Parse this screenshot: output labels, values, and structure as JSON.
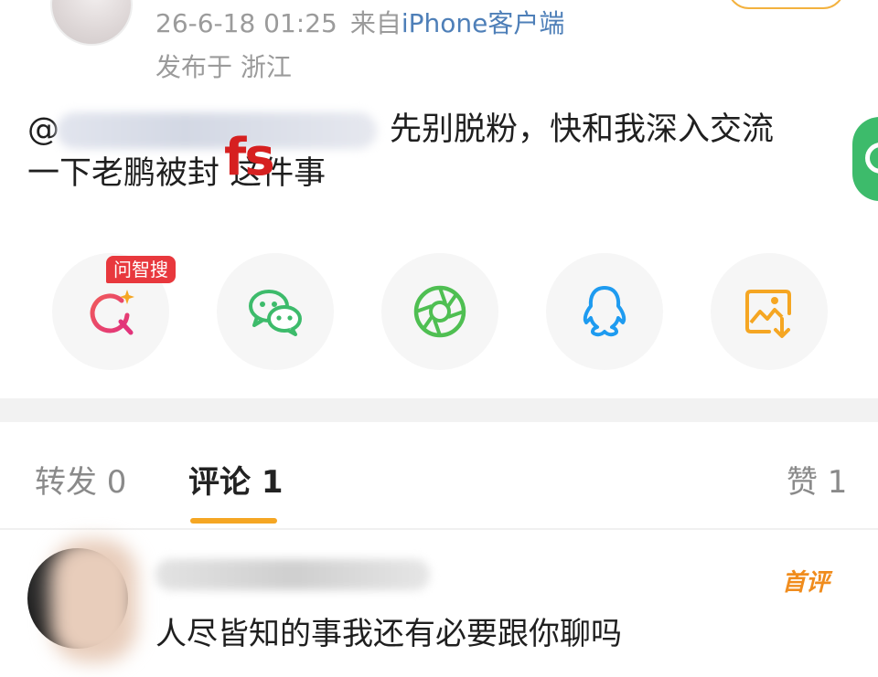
{
  "post": {
    "timestamp": "26-6-18 01:25",
    "source_prefix": "来自",
    "source_client": "iPhone客户端",
    "location": "发布于 浙江",
    "content_at": "@",
    "content_line1_tail": "先别脱粉，快和我深入交流",
    "content_line2": "一下老鹏被封 这件事",
    "overlay_text": "fs"
  },
  "share": {
    "ai_badge": "问智搜",
    "icons": [
      "search-ai-icon",
      "wechat-icon",
      "moments-icon",
      "qq-icon",
      "save-image-icon"
    ]
  },
  "tabs": {
    "repost": "转发 0",
    "comments": "评论 1",
    "likes": "赞 1"
  },
  "comment": {
    "badge": "首评",
    "text": "人尽皆知的事我还有必要跟你聊吗"
  },
  "colors": {
    "accent": "#f5a623",
    "link": "#4e7fb8",
    "badge_red": "#e8383d",
    "wechat_green": "#3dbb6b",
    "qq_blue": "#1e9bf0",
    "save_orange": "#f5a623"
  }
}
